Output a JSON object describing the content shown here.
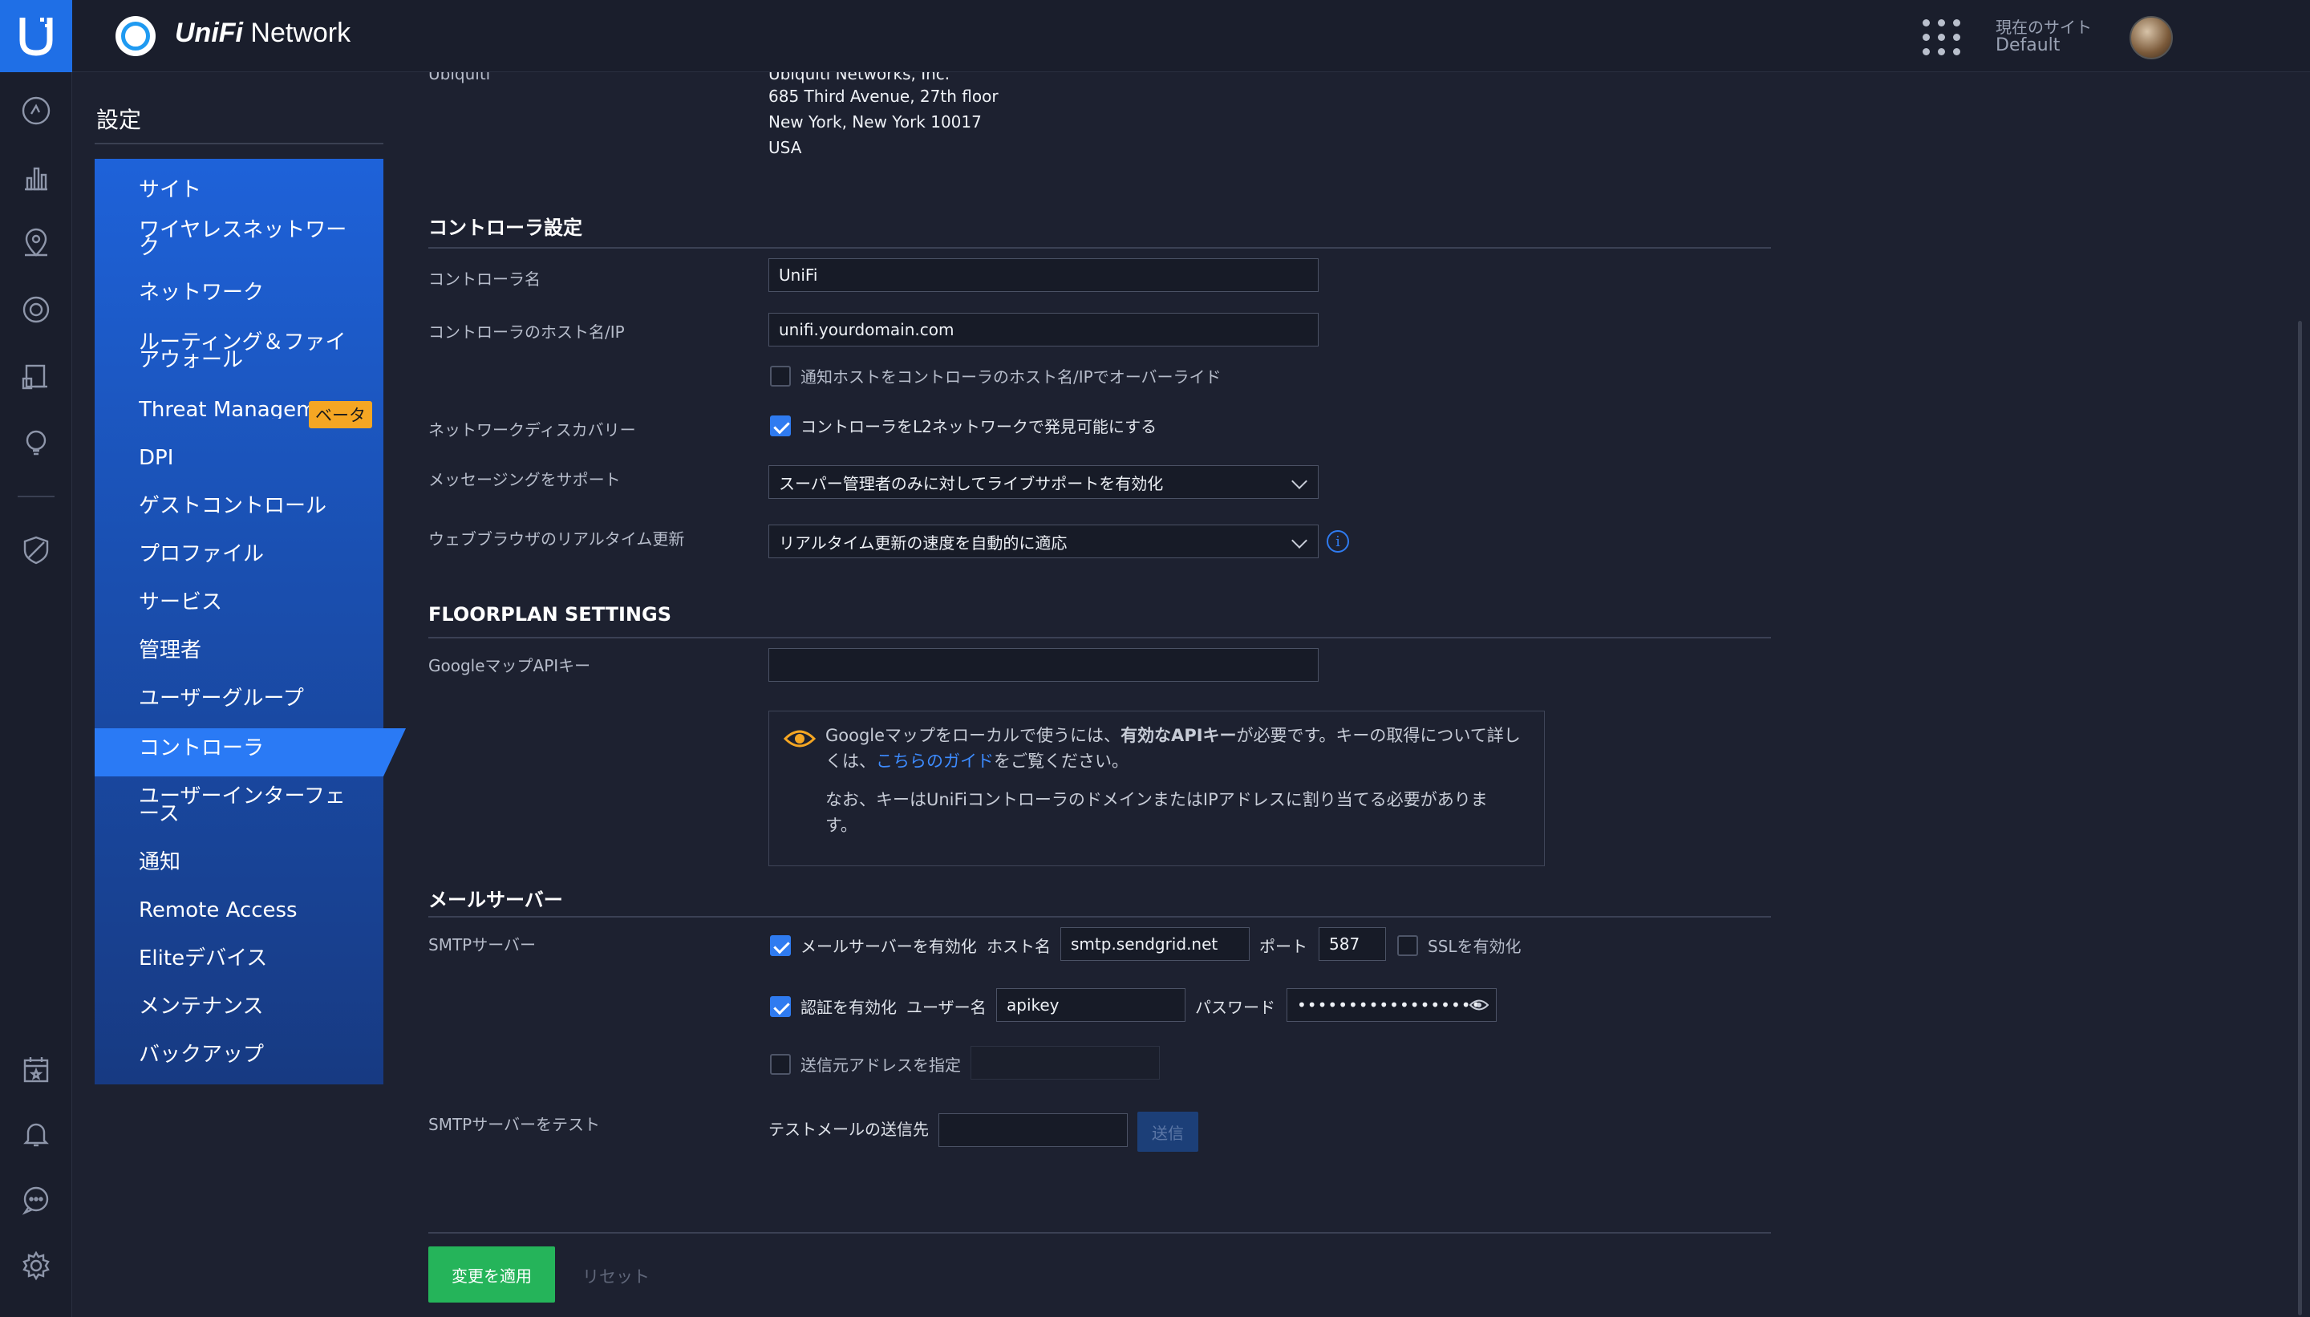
{
  "topbar": {
    "brand_bold": "UniFi",
    "brand_rest": " Network",
    "site_label": "現在のサイト",
    "site_value": "Default"
  },
  "sidebar": {
    "title": "設定",
    "items": [
      {
        "label": "サイト"
      },
      {
        "label": "ワイヤレスネットワーク"
      },
      {
        "label": "ネットワーク"
      },
      {
        "label": "ルーティング＆ファイアウォール"
      },
      {
        "label": "Threat Management"
      },
      {
        "label": "DPI"
      },
      {
        "label": "ゲストコントロール"
      },
      {
        "label": "プロファイル"
      },
      {
        "label": "サービス"
      },
      {
        "label": "管理者"
      },
      {
        "label": "ユーザーグループ"
      },
      {
        "label": "コントローラ"
      },
      {
        "label": "ユーザーインターフェース"
      },
      {
        "label": "通知"
      },
      {
        "label": "Remote Access"
      },
      {
        "label": "Eliteデバイス"
      },
      {
        "label": "メンテナンス"
      },
      {
        "label": "バックアップ"
      }
    ],
    "beta_badge": "ベータ",
    "active_item": "コントローラ"
  },
  "company": {
    "label": "Ubiquiti",
    "lines": [
      "Ubiquiti Networks, Inc.",
      "685 Third Avenue, 27th floor",
      "New York, New York 10017",
      "USA"
    ]
  },
  "controller": {
    "section": "コントローラ設定",
    "name_label": "コントローラ名",
    "name_value": "UniFi",
    "host_label": "コントローラのホスト名/IP",
    "host_value": "unifi.yourdomain.com",
    "override_label": "通知ホストをコントローラのホスト名/IPでオーバーライド",
    "override_checked": false,
    "discovery_label": "ネットワークディスカバリー",
    "discovery_text": "コントローラをL2ネットワークで発見可能にする",
    "discovery_checked": true,
    "messaging_label": "メッセージングをサポート",
    "messaging_value": "スーパー管理者のみに対してライブサポートを有効化",
    "realtime_label": "ウェブブラウザのリアルタイム更新",
    "realtime_value": "リアルタイム更新の速度を自動的に適応"
  },
  "floorplan": {
    "section": "FLOORPLAN SETTINGS",
    "api_label": "GoogleマップAPIキー",
    "api_value": "",
    "notice_line1_a": "Googleマップをローカルで使うには、",
    "notice_line1_b": "有効なAPIキー",
    "notice_line1_c": "が必要です。キーの取得について詳し",
    "notice_line2_a": "くは、",
    "notice_line2_link": "こちらのガイド",
    "notice_line2_b": "をご覧ください。",
    "notice_line3": "なお、キーはUniFiコントローラのドメインまたはIPアドレスに割り当てる必要がありま",
    "notice_line4": "す。"
  },
  "mail": {
    "section": "メールサーバー",
    "smtp_label": "SMTPサーバー",
    "enable_text": "メールサーバーを有効化",
    "enable_checked": true,
    "host_label": "ホスト名",
    "host_value": "smtp.sendgrid.net",
    "port_label": "ポート",
    "port_value": "587",
    "ssl_text": "SSLを有効化",
    "ssl_checked": false,
    "auth_text": "認証を有効化",
    "auth_checked": true,
    "user_label": "ユーザー名",
    "user_value": "apikey",
    "pass_label": "パスワード",
    "pass_value": "••••••••••••••••••",
    "sender_text": "送信元アドレスを指定",
    "sender_checked": false,
    "test_label": "SMTPサーバーをテスト",
    "test_to_label": "テストメールの送信先",
    "test_to_value": "",
    "send_button": "送信"
  },
  "actions": {
    "apply": "変更を適用",
    "reset": "リセット"
  },
  "colors": {
    "accent": "#2f7bf0",
    "menu_blue": "#1e62d9",
    "apply_green": "#25b45a",
    "beta_orange": "#f5a623"
  }
}
